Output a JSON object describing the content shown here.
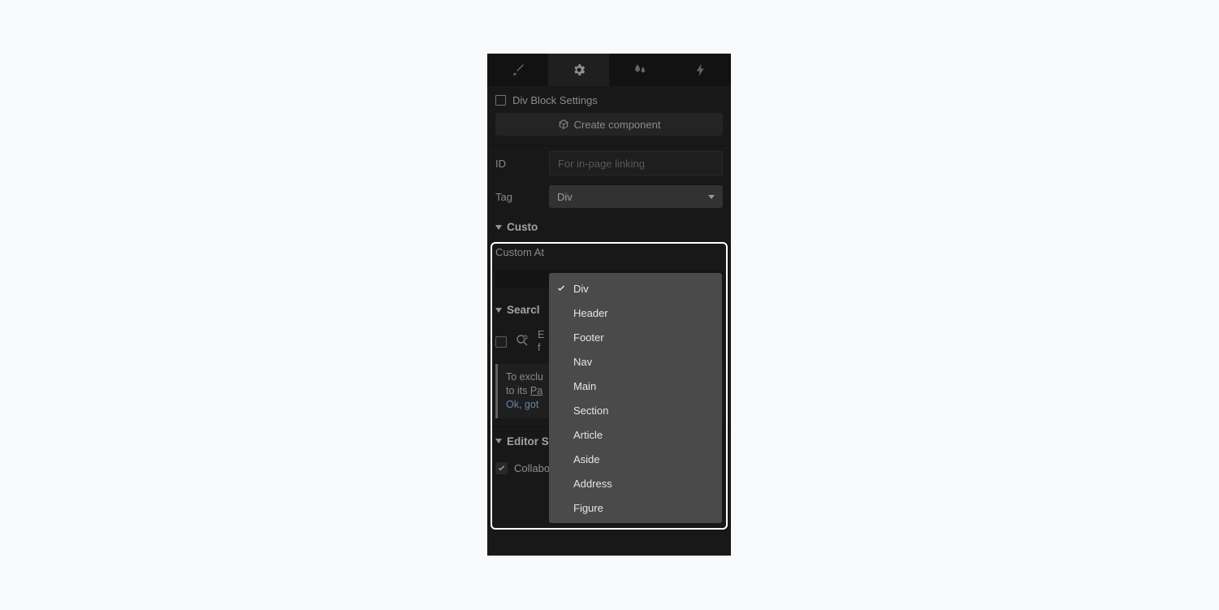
{
  "header": {
    "title": "Div Block Settings",
    "create_component": "Create component"
  },
  "fields": {
    "id_label": "ID",
    "id_placeholder": "For in-page linking",
    "tag_label": "Tag",
    "tag_value": "Div"
  },
  "tag_options": [
    "Div",
    "Header",
    "Footer",
    "Nav",
    "Main",
    "Section",
    "Article",
    "Aside",
    "Address",
    "Figure"
  ],
  "sections": {
    "custom_attr_header": "Custom attributes",
    "custom_attr_header_truncated": "Custo",
    "custom_attr_label": "Custom At",
    "search_header": "Search index settings",
    "search_header_truncated": "Searcl",
    "search_exclude_line1": "E",
    "search_exclude_line2": "f",
    "hint_line1": "To exclu",
    "hint_line2_prefix": "to its ",
    "hint_line2_link": "Pa",
    "ok": "Ok, got",
    "editor_header": "Editor Settings",
    "collab_label": "Collaborators can edit this element"
  }
}
